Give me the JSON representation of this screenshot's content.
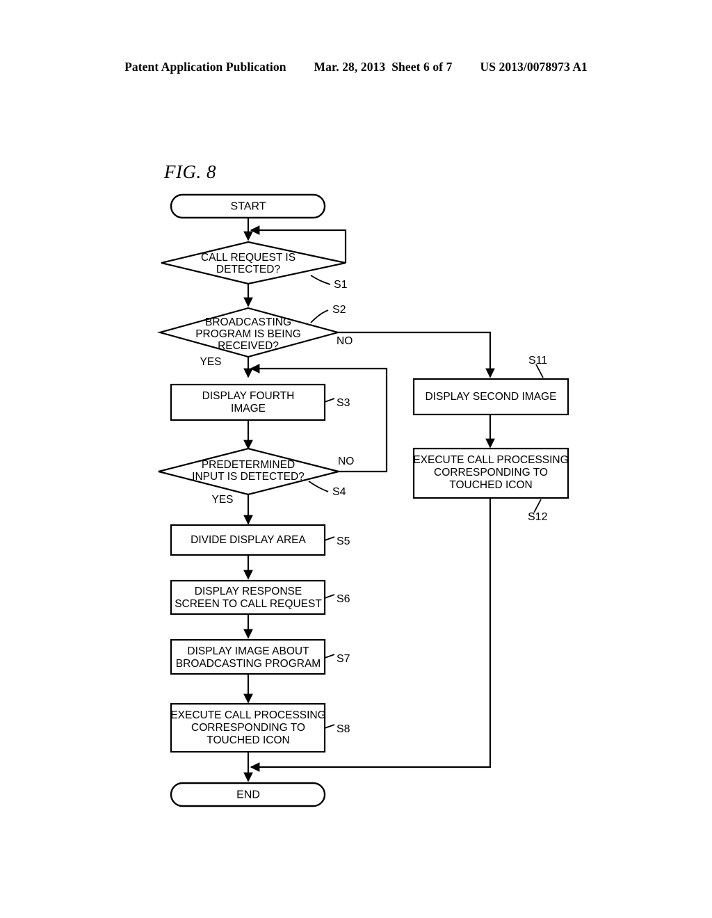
{
  "header": {
    "publication": "Patent Application Publication",
    "date_sheet": "Mar. 28, 2013  Sheet 6 of 7",
    "patent_number": "US 2013/0078973 A1"
  },
  "figure": {
    "title": "FIG. 8"
  },
  "flowchart": {
    "nodes": {
      "start": {
        "label": "START",
        "type": "terminator"
      },
      "s1": {
        "label_line1": "CALL REQUEST IS",
        "label_line2": "DETECTED?",
        "step": "S1",
        "type": "decision"
      },
      "s2": {
        "label_line1": "BROADCASTING",
        "label_line2": "PROGRAM IS BEING",
        "label_line3": "RECEIVED?",
        "step": "S2",
        "type": "decision"
      },
      "s3": {
        "label_line1": "DISPLAY FOURTH",
        "label_line2": "IMAGE",
        "step": "S3",
        "type": "process"
      },
      "s4": {
        "label_line1": "PREDETERMINED",
        "label_line2": "INPUT IS DETECTED?",
        "step": "S4",
        "type": "decision"
      },
      "s5": {
        "label_line1": "DIVIDE DISPLAY AREA",
        "step": "S5",
        "type": "process"
      },
      "s6": {
        "label_line1": "DISPLAY RESPONSE",
        "label_line2": "SCREEN TO CALL REQUEST",
        "step": "S6",
        "type": "process"
      },
      "s7": {
        "label_line1": "DISPLAY IMAGE ABOUT",
        "label_line2": "BROADCASTING PROGRAM",
        "step": "S7",
        "type": "process"
      },
      "s8": {
        "label_line1": "EXECUTE CALL PROCESSING",
        "label_line2": "CORRESPONDING TO",
        "label_line3": "TOUCHED ICON",
        "step": "S8",
        "type": "process"
      },
      "s11": {
        "label_line1": "DISPLAY SECOND IMAGE",
        "step": "S11",
        "type": "process"
      },
      "s12": {
        "label_line1": "EXECUTE CALL PROCESSING",
        "label_line2": "CORRESPONDING TO",
        "label_line3": "TOUCHED ICON",
        "step": "S12",
        "type": "process"
      },
      "end": {
        "label": "END",
        "type": "terminator"
      }
    },
    "branch_labels": {
      "s2_yes": "YES",
      "s2_no": "NO",
      "s4_yes": "YES",
      "s4_no": "NO"
    },
    "colors": {
      "stroke": "#000000",
      "fill": "#ffffff",
      "text": "#000000"
    }
  }
}
